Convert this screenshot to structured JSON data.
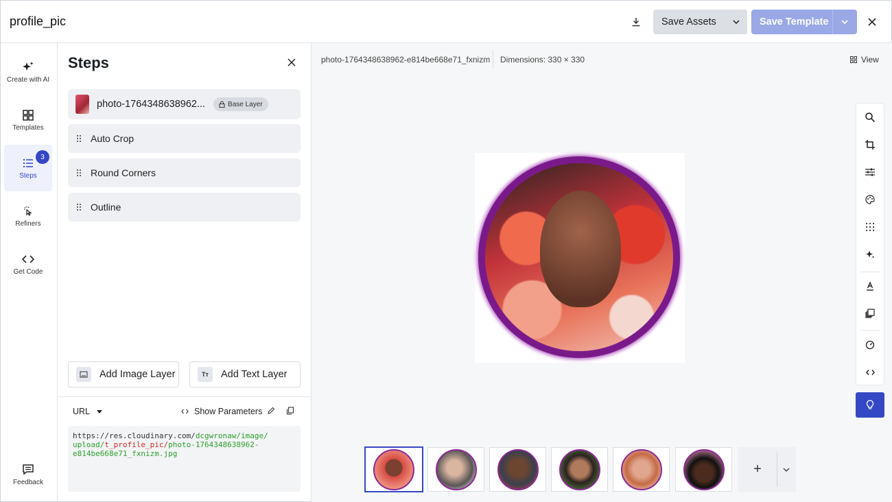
{
  "header": {
    "title": "profile_pic",
    "save_assets_label": "Save Assets",
    "save_template_label": "Save Template"
  },
  "rail": {
    "items": [
      {
        "label": "Create with AI",
        "icon": "sparkle-icon"
      },
      {
        "label": "Templates",
        "icon": "grid-icon"
      },
      {
        "label": "Steps",
        "icon": "list-icon",
        "badge": "3"
      },
      {
        "label": "Refiners",
        "icon": "pointer-icon"
      },
      {
        "label": "Get Code",
        "icon": "code-icon"
      },
      {
        "label": "Feedback",
        "icon": "feedback-icon"
      }
    ]
  },
  "steps_panel": {
    "title": "Steps",
    "base_layer": {
      "name": "photo-1764348638962...",
      "badge": "Base Layer"
    },
    "steps": [
      {
        "label": "Auto Crop"
      },
      {
        "label": "Round Corners"
      },
      {
        "label": "Outline"
      }
    ],
    "add_image_label": "Add Image Layer",
    "add_text_label": "Add Text Layer",
    "add_text_icon": "Tт",
    "url_select": "URL",
    "show_params_label": "Show Parameters",
    "url": {
      "part1": "https://res.cloudinary.com/",
      "part2": "dcgwronaw/image/",
      "part3": "upload/",
      "part4": "t_profile_pic/",
      "part5": "photo-1764348638962-",
      "part6": "e814be668e71_fxnizm.jpg"
    }
  },
  "canvas": {
    "filename": "photo-1764348638962-e814be668e71_fxnizm",
    "dimensions": "Dimensions: 330 × 330",
    "view_label": "View"
  },
  "accent_color": "#3448c5",
  "outline_color": "#7a1a8a"
}
